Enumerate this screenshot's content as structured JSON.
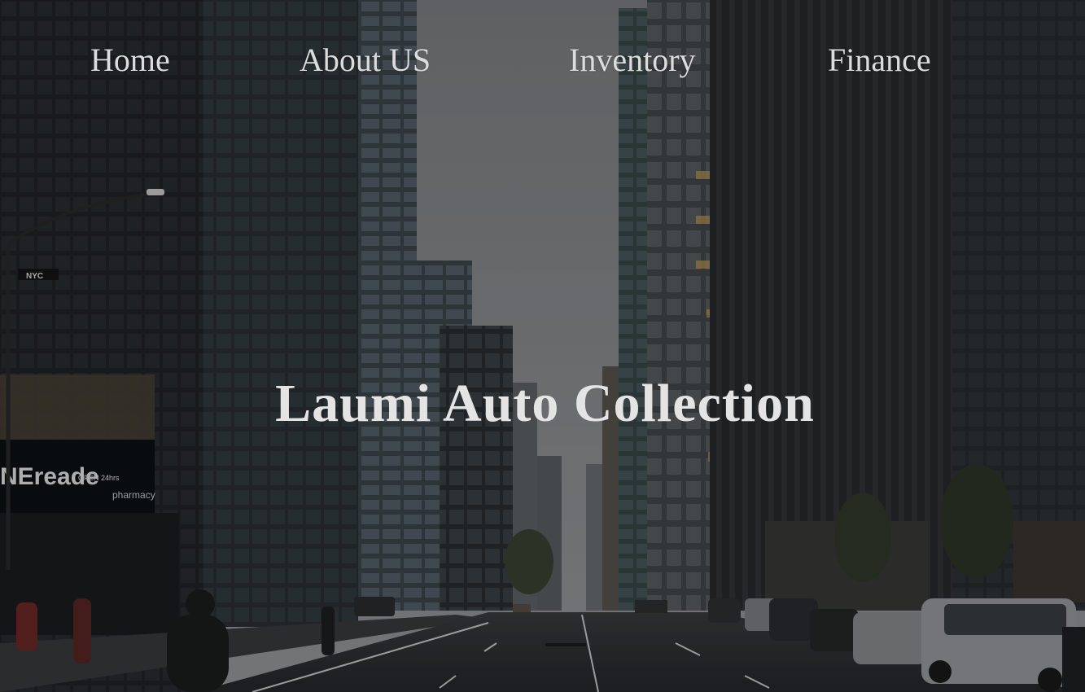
{
  "nav": {
    "home": "Home",
    "about": "About US",
    "inventory": "Inventory",
    "finance": "Finance"
  },
  "hero": {
    "title": "Laumi Auto Collection"
  },
  "background": {
    "storefront_sign": "NEreade",
    "storefront_sign_sub": "OPEN 24hrs",
    "storefront_sign_right": "pharmacy",
    "pole_sign": "NYC"
  },
  "colors": {
    "nav_text": "#dcdcdc",
    "title_text": "#e4e4e4",
    "sky": "#8a8c8f",
    "buildings_dark": "#1f2326",
    "road": "#2d2f32"
  }
}
